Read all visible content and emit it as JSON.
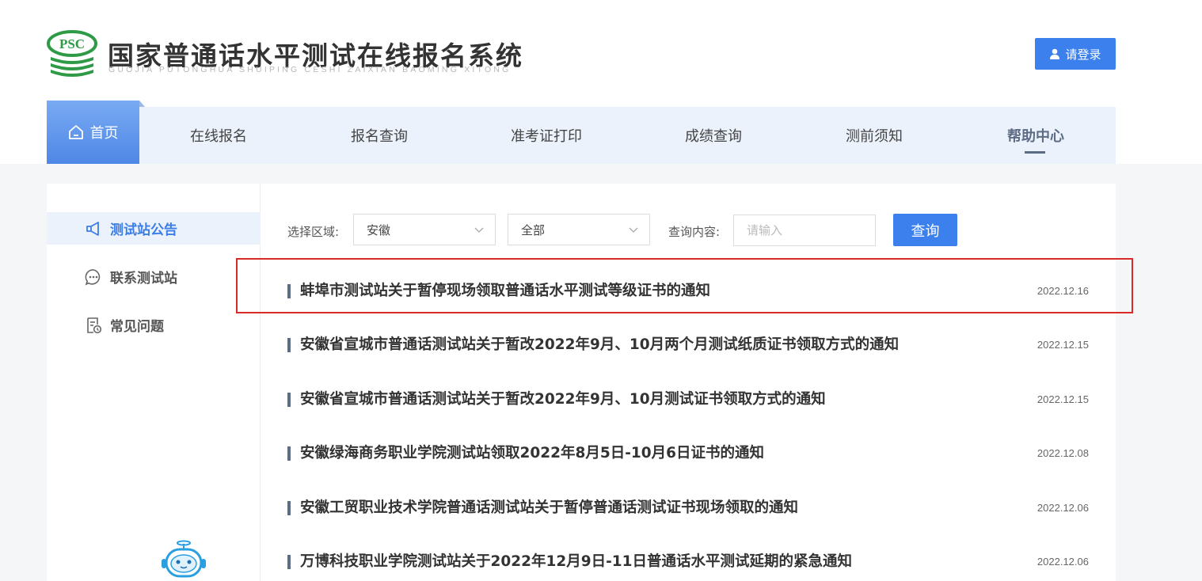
{
  "header": {
    "logo_text": "PSC",
    "title": "国家普通话水平测试在线报名系统",
    "subtitle": "GUOJIA PUTONGHUA SHUIPING CESHI ZAIXIAN BAOMING XITONG",
    "login_label": "请登录"
  },
  "nav": {
    "home": "首页",
    "items": [
      "在线报名",
      "报名查询",
      "准考证打印",
      "成绩查询",
      "测前须知",
      "帮助中心"
    ],
    "active": "帮助中心"
  },
  "sidebar": {
    "items": [
      {
        "label": "测试站公告",
        "icon": "megaphone-icon",
        "active": true
      },
      {
        "label": "联系测试站",
        "icon": "chat-bubble-icon",
        "active": false
      },
      {
        "label": "常见问题",
        "icon": "document-clock-icon",
        "active": false
      }
    ]
  },
  "filter": {
    "region_label": "选择区域:",
    "region_value": "安徽",
    "scope_value": "全部",
    "query_label": "查询内容:",
    "query_placeholder": "请输入",
    "query_button": "查询"
  },
  "news": [
    {
      "title": "蚌埠市测试站关于暂停现场领取普通话水平测试等级证书的通知",
      "date": "2022.12.16"
    },
    {
      "title": "安徽省宣城市普通话测试站关于暂改2022年9月、10月两个月测试纸质证书领取方式的通知",
      "date": "2022.12.15"
    },
    {
      "title": "安徽省宣城市普通话测试站关于暂改2022年9月、10月测试证书领取方式的通知",
      "date": "2022.12.15"
    },
    {
      "title": "安徽绿海商务职业学院测试站领取2022年8月5日-10月6日证书的通知",
      "date": "2022.12.08"
    },
    {
      "title": "安徽工贸职业技术学院普通话测试站关于暂停普通话测试证书现场领取的通知",
      "date": "2022.12.06"
    },
    {
      "title": "万博科技职业学院测试站关于2022年12月9日-11日普通话水平测试延期的紧急通知",
      "date": "2022.12.06"
    }
  ],
  "colors": {
    "accent": "#3b80ec",
    "nav_bg": "#ebf2fc",
    "highlight": "#d92a2a",
    "logo_green": "#2f9a45"
  }
}
